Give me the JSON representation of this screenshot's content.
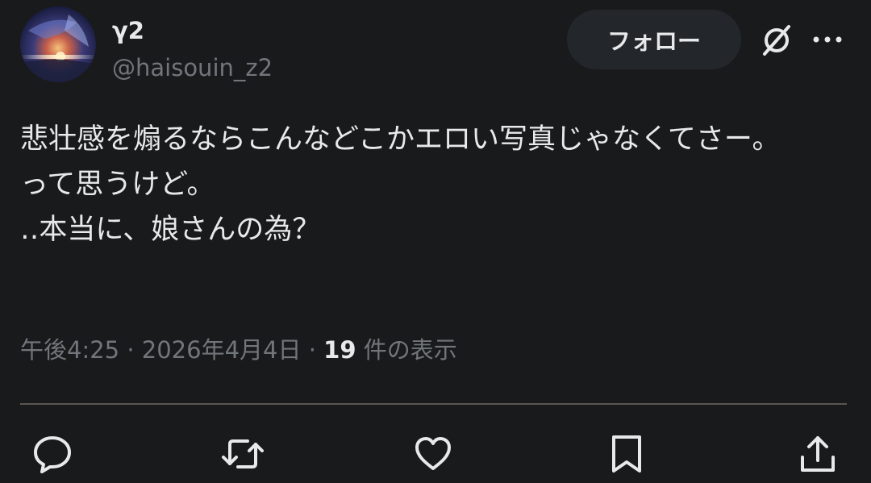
{
  "author": {
    "display_name": "γ2",
    "handle": "@haisouin_z2"
  },
  "header": {
    "follow_label": "フォロー",
    "grok_icon": "grok-icon",
    "more_icon": "more-icon"
  },
  "tweet": {
    "text": "悲壮感を煽るならこんなどこかエロい写真じゃなくてさー。\nって思うけど。\n‥本当に、娘さんの為？"
  },
  "meta": {
    "time": "午後4:25",
    "separator": " · ",
    "date": "2026年4月4日",
    "views_count": "19",
    "views_label": " 件の表示"
  },
  "actions": {
    "icons": [
      "reply-icon",
      "retweet-icon",
      "like-icon",
      "bookmark-icon",
      "share-icon"
    ]
  },
  "colors": {
    "background": "#191a1c",
    "text": "#e7e9ea",
    "secondary_text": "#71767b",
    "follow_button_bg": "#23272b",
    "divider": "#5a5550"
  }
}
